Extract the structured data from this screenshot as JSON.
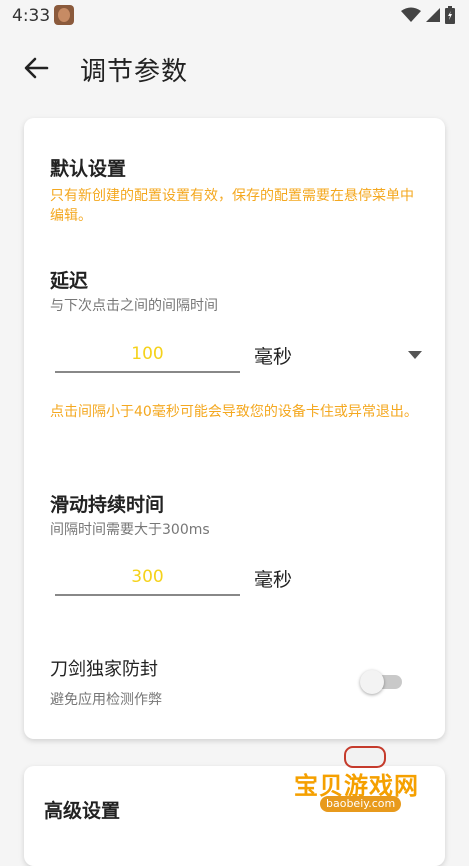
{
  "status_bar": {
    "time": "4:33"
  },
  "header": {
    "title": "调节参数"
  },
  "default_settings": {
    "title": "默认设置",
    "note": "只有新创建的配置设置有效，保存的配置需要在悬停菜单中编辑。",
    "delay": {
      "title": "延迟",
      "subtitle": "与下次点击之间的间隔时间",
      "value": "100",
      "unit": "毫秒",
      "warning": "点击间隔小于40毫秒可能会导致您的设备卡住或异常退出。"
    },
    "swipe_duration": {
      "title": "滑动持续时间",
      "subtitle": "间隔时间需要大于300ms",
      "value": "300",
      "unit": "毫秒"
    },
    "anti_ban": {
      "title": "刀剑独家防封",
      "subtitle": "避免应用检测作弊",
      "enabled": false
    }
  },
  "advanced_settings": {
    "title": "高级设置"
  },
  "watermark": {
    "brand": "宝贝游戏网",
    "url": "baobeiy.com"
  },
  "colors": {
    "accent_orange": "#f4a820",
    "input_value_yellow": "#f5d21b"
  }
}
